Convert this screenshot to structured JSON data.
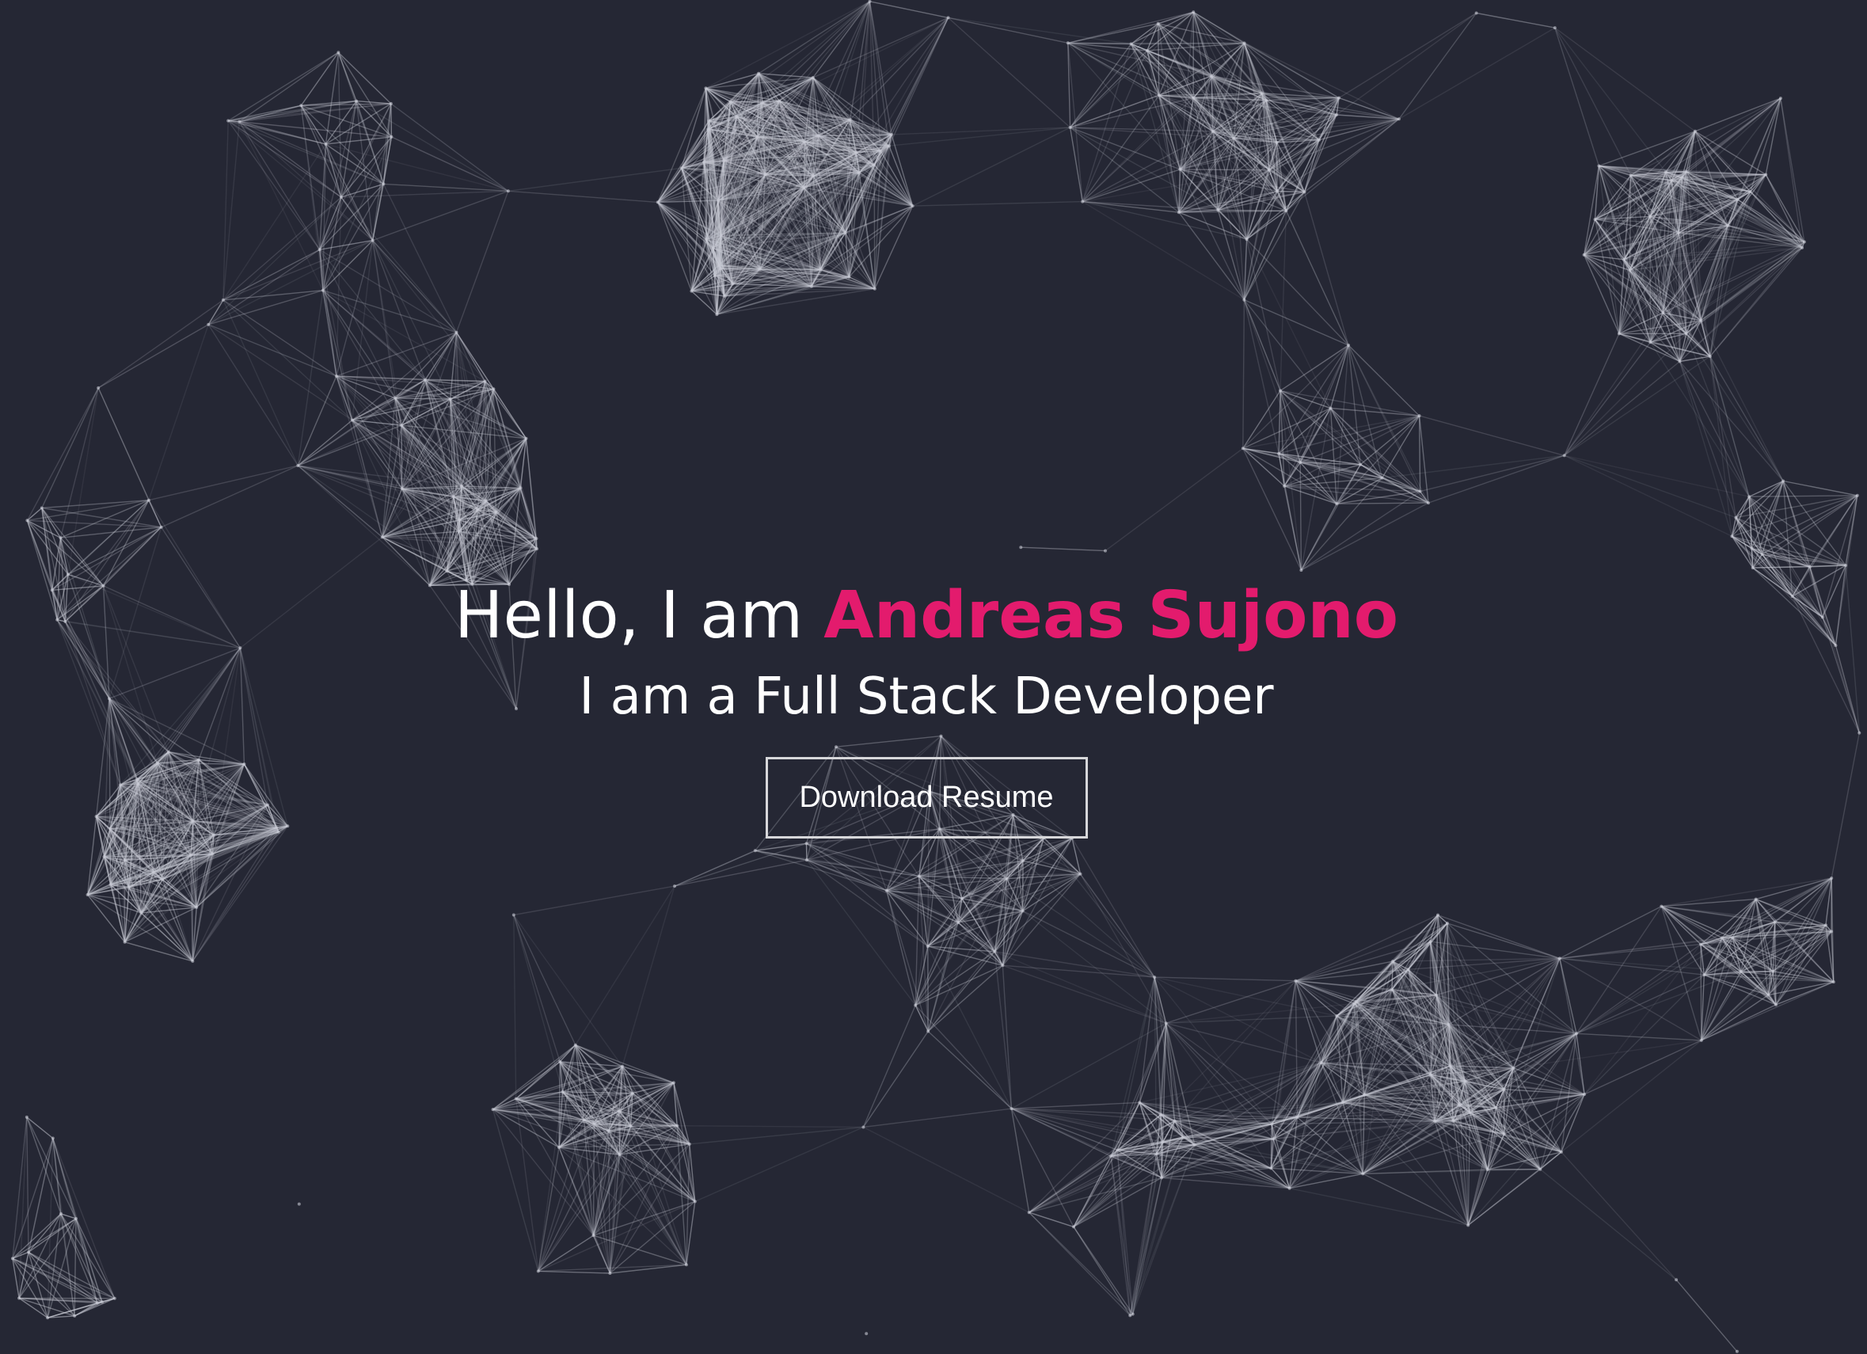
{
  "colors": {
    "background": "#252734",
    "accent": "#e31b6d",
    "text": "#ffffff",
    "line": "#c8cad4"
  },
  "hero": {
    "greeting_prefix": "Hello, I am ",
    "name": "Andreas Sujono",
    "tagline": "I am a Full Stack Developer",
    "button_label": "Download Resume"
  },
  "background": {
    "type": "particle-network"
  }
}
